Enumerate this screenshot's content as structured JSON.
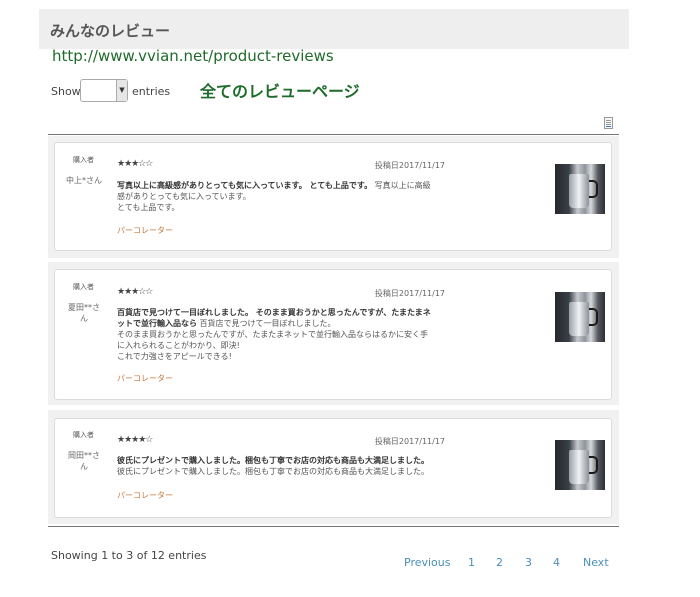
{
  "header": {
    "title": "みんなのレビュー"
  },
  "url_text": "http://www.vvian.net/product-reviews",
  "length_control": {
    "show_label": "Show",
    "selected": "",
    "entries_label": "entries"
  },
  "all_reviews_title": "全てのレビューページ",
  "export_icon": "document-icon",
  "reviews": [
    {
      "buyer_label": "購入者",
      "buyer_name": "中上*さん",
      "stars": "★★★☆☆",
      "rating": 3,
      "date": "投稿日2017/11/17",
      "title": "写真以上に高級感がありとっても気に入っています。 とても上品です。",
      "body": "写真以上に高級感がありとっても気に入っています。\nとても上品です。",
      "product": "パーコレーター"
    },
    {
      "buyer_label": "購入者",
      "buyer_name": "夏田**さん",
      "stars": "★★★☆☆",
      "rating": 3,
      "date": "投稿日2017/11/17",
      "title": "百貨店で見つけて一目ぼれしました。 そのまま買おうかと思ったんですが、たまたまネットで並行輸入品なら",
      "body": "百貨店で見つけて一目ぼれしました。\nそのまま買おうかと思ったんですが、たまたまネットで並行輸入品ならはるかに安く手に入れられることがわかり、即決!\nこれで力強さをアピールできる!",
      "product": "パーコレーター"
    },
    {
      "buyer_label": "購入者",
      "buyer_name": "岡田**さん",
      "stars": "★★★★☆",
      "rating": 4,
      "date": "投稿日2017/11/17",
      "title": "彼氏にプレゼントで購入しました。梱包も丁寧でお店の対応も商品も大満足しました。",
      "body": "彼氏にプレゼントで購入しました。梱包も丁寧でお店の対応も商品も大満足しました。",
      "product": "パーコレーター"
    }
  ],
  "table_info": "Showing 1 to 3 of 12 entries",
  "pagination": {
    "previous": "Previous",
    "pages": [
      "1",
      "2",
      "3",
      "4"
    ],
    "next": "Next"
  }
}
